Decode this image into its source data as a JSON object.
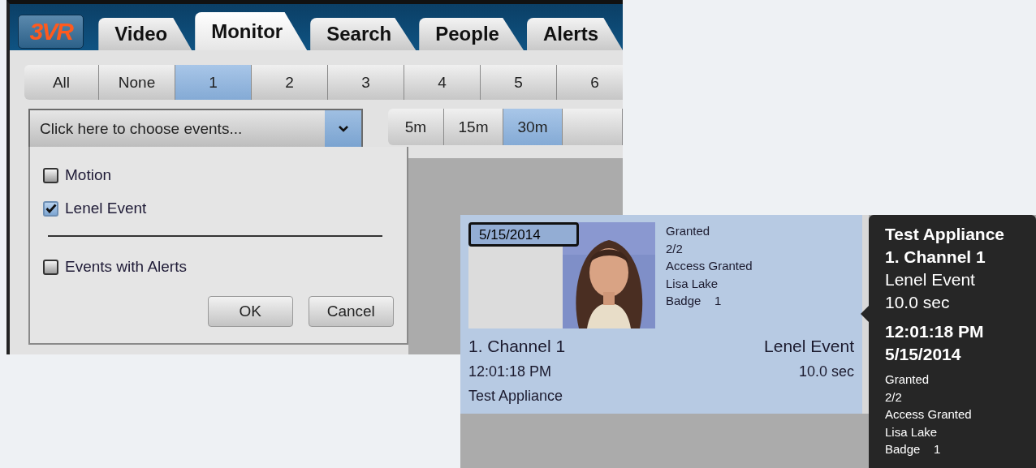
{
  "monitor_window": {
    "logo": "3VR",
    "tabs": [
      {
        "label": "Video",
        "selected": false
      },
      {
        "label": "Monitor",
        "selected": true
      },
      {
        "label": "Search",
        "selected": false
      },
      {
        "label": "People",
        "selected": false
      },
      {
        "label": "Alerts",
        "selected": false
      }
    ],
    "channel_buttons": [
      {
        "label": "All",
        "selected": false
      },
      {
        "label": "None",
        "selected": false
      },
      {
        "label": "1",
        "selected": true
      },
      {
        "label": "2",
        "selected": false
      },
      {
        "label": "3",
        "selected": false
      },
      {
        "label": "4",
        "selected": false
      },
      {
        "label": "5",
        "selected": false
      },
      {
        "label": "6",
        "selected": false
      }
    ],
    "event_dropdown": {
      "value": "Click here to choose events...",
      "expanded": true
    },
    "time_buttons": [
      {
        "label": "5m",
        "selected": false
      },
      {
        "label": "15m",
        "selected": false
      },
      {
        "label": "30m",
        "selected": true
      }
    ],
    "event_options": [
      {
        "label": "Motion",
        "checked": false
      },
      {
        "label": "Lenel Event",
        "checked": true
      },
      {
        "label": "Events with Alerts",
        "checked": false
      }
    ],
    "buttons": [
      "OK",
      "Cancel"
    ]
  },
  "event_card": {
    "date": "5/15/2014",
    "details": [
      "Granted",
      "2/2",
      "Access Granted",
      "Lisa Lake",
      "Badge    1"
    ],
    "channel": "1. Channel 1",
    "event": "Lenel Event",
    "time": "12:01:18 PM",
    "duration": "10.0 sec",
    "appliance": "Test Appliance"
  },
  "tooltip": {
    "bold_lines": [
      "Test Appliance",
      "1. Channel 1"
    ],
    "lines": [
      "Lenel Event",
      "10.0 sec"
    ],
    "bold_lines_2": [
      "12:01:18 PM",
      "5/15/2014"
    ],
    "details": [
      "Granted",
      "2/2",
      "Access Granted",
      "Lisa Lake",
      "Badge    1"
    ]
  }
}
